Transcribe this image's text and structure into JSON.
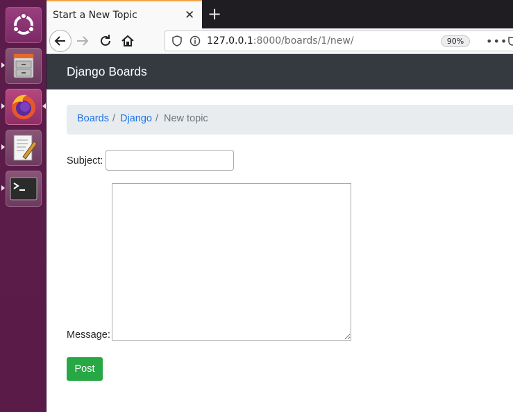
{
  "launcher": {
    "items": [
      {
        "name": "ubuntu-dash"
      },
      {
        "name": "files"
      },
      {
        "name": "firefox"
      },
      {
        "name": "text-editor"
      },
      {
        "name": "terminal"
      }
    ]
  },
  "browser": {
    "tab_title": "Start a New Topic",
    "tab_close_glyph": "✕",
    "new_tab_glyph": "+",
    "url_host": "127.0.0.1",
    "url_rest": ":8000/boards/1/new/",
    "zoom": "90%",
    "more_glyph": "•••"
  },
  "navbar": {
    "brand": "Django Boards"
  },
  "breadcrumb": {
    "items": [
      "Boards",
      "Django",
      "New topic"
    ],
    "separator": "/"
  },
  "form": {
    "subject_label": "Subject:",
    "subject_value": "",
    "message_label": "Message:",
    "message_value": "",
    "submit_label": "Post"
  },
  "colors": {
    "navbar_bg": "#343a40",
    "link": "#1a73e8",
    "post_button": "#28a745",
    "launcher_bg": "#5c1c4b",
    "tab_accent": "#f2a64a"
  }
}
